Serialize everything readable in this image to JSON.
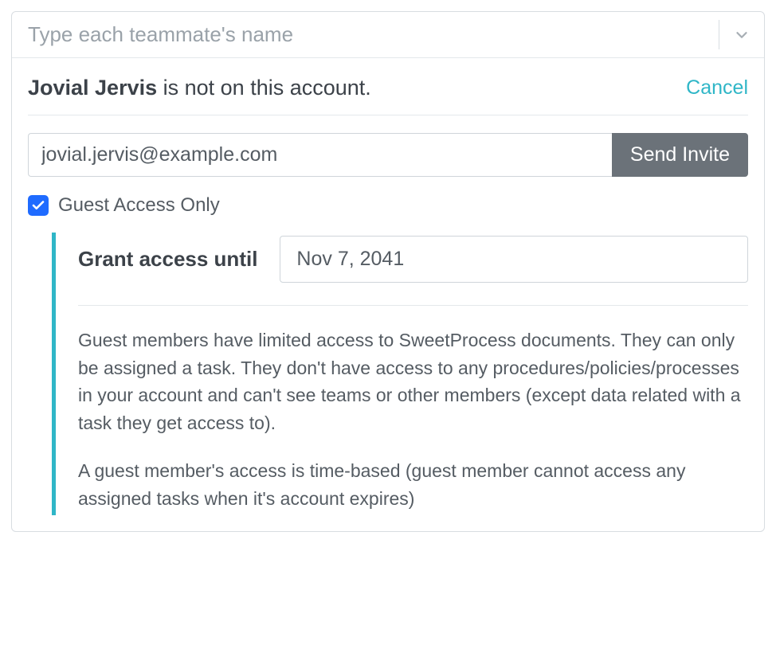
{
  "teammate_select": {
    "placeholder": "Type each teammate's name",
    "value": ""
  },
  "status": {
    "name": "Jovial Jervis",
    "suffix": " is not on this account.",
    "cancel_label": "Cancel"
  },
  "invite": {
    "email": "jovial.jervis@example.com",
    "send_label": "Send Invite"
  },
  "guest": {
    "checkbox_checked": true,
    "checkbox_label": "Guest Access Only",
    "grant_label": "Grant access until",
    "grant_date": "Nov 7, 2041",
    "description_p1": "Guest members have limited access to SweetProcess documents. They can only be assigned a task. They don't have access to any procedures/policies/processes in your account and can't see teams or other members (except data related with a task they get access to).",
    "description_p2": "A guest member's access is time-based (guest member cannot access any assigned tasks when it's account expires)"
  }
}
